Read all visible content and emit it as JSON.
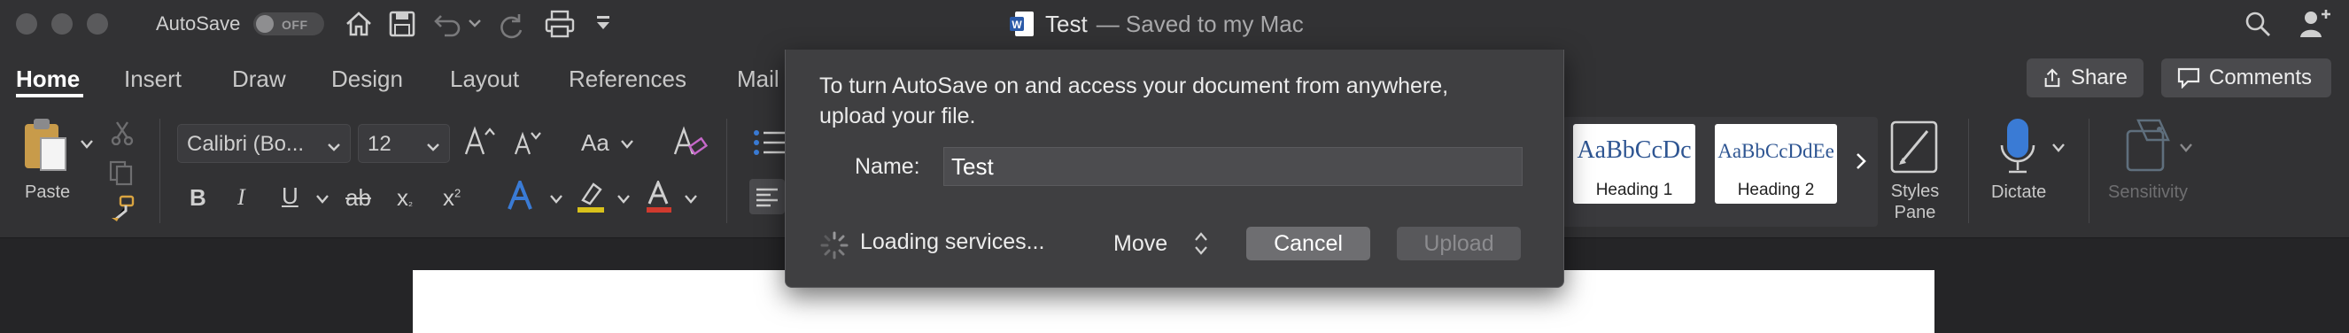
{
  "titlebar": {
    "autosave_label": "AutoSave",
    "autosave_state": "OFF",
    "doc_name": "Test",
    "doc_status": "— Saved to my Mac"
  },
  "tabs": [
    "Home",
    "Insert",
    "Draw",
    "Design",
    "Layout",
    "References",
    "Mail"
  ],
  "active_tab": "Home",
  "share_label": "Share",
  "comments_label": "Comments",
  "ribbon": {
    "paste_label": "Paste",
    "font_name": "Calibri (Bo...",
    "font_size": "12",
    "change_case": "Aa",
    "bold": "B",
    "italic": "I",
    "underline": "U",
    "strike": "ab",
    "subscript": "x",
    "superscript": "x",
    "styles": [
      {
        "sample": "AaBbCcDc",
        "name": "Heading 1"
      },
      {
        "sample": "AaBbCcDdEe",
        "name": "Heading 2"
      }
    ],
    "styles_pane_line1": "Styles",
    "styles_pane_line2": "Pane",
    "dictate_label": "Dictate",
    "sensitivity_label": "Sensitivity"
  },
  "dialog": {
    "message": "To turn AutoSave on and access your document from anywhere, upload your file.",
    "name_label": "Name:",
    "name_value": "Test",
    "loading_text": "Loading services...",
    "location": "Move",
    "cancel_label": "Cancel",
    "upload_label": "Upload"
  },
  "colors": {
    "highlight": "#d8c11b",
    "font_color": "#d03a2e",
    "heading_text": "#2e5592"
  }
}
